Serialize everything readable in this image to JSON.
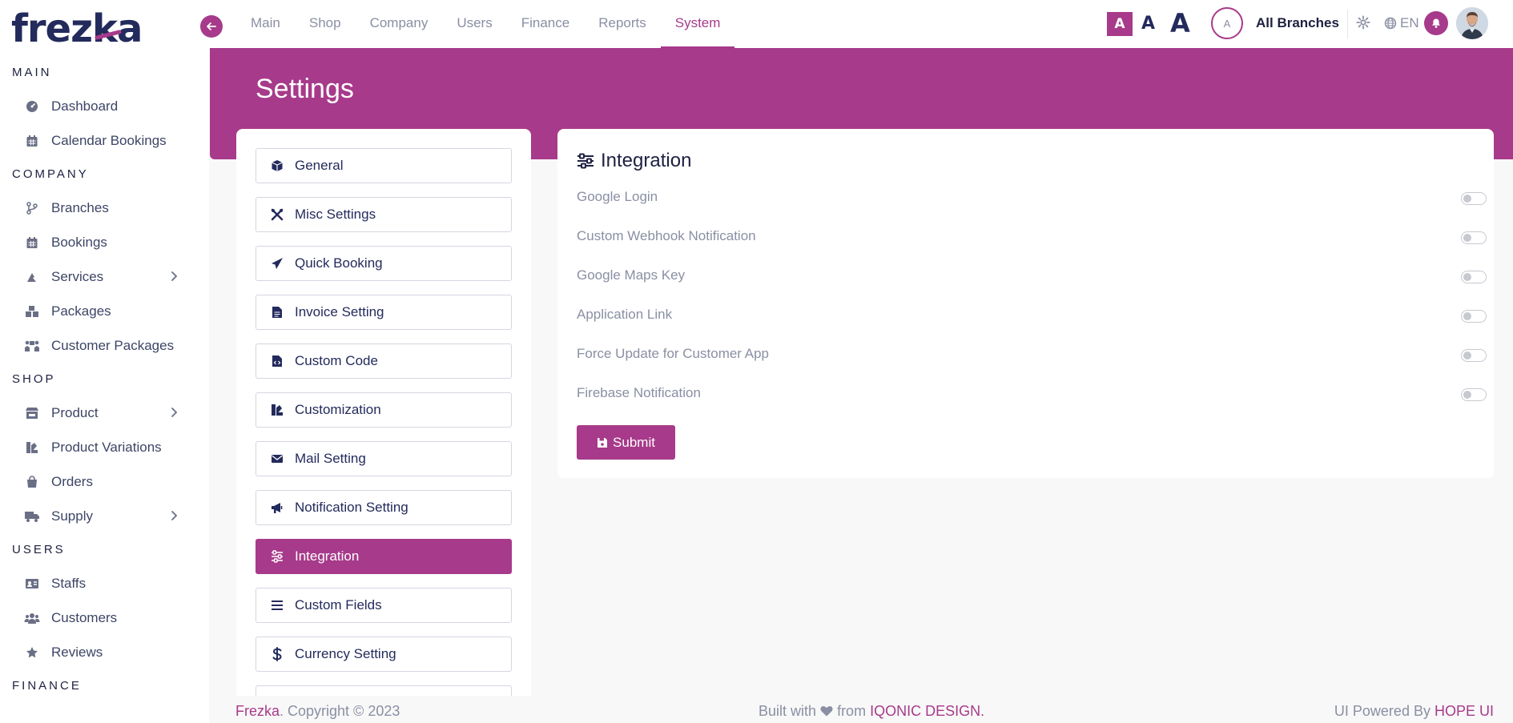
{
  "brand": {
    "logo_text_a": "frez",
    "logo_text_k": "k",
    "logo_text_b": "a"
  },
  "sidebar": {
    "sections": [
      {
        "title": "MAIN",
        "items": [
          {
            "label": "Dashboard",
            "icon": "dashboard-icon"
          },
          {
            "label": "Calendar Bookings",
            "icon": "calendar-icon"
          }
        ]
      },
      {
        "title": "COMPANY",
        "items": [
          {
            "label": "Branches",
            "icon": "branch-icon"
          },
          {
            "label": "Bookings",
            "icon": "calendar-icon"
          },
          {
            "label": "Services",
            "icon": "services-icon",
            "chevron": true
          },
          {
            "label": "Packages",
            "icon": "packages-icon"
          },
          {
            "label": "Customer Packages",
            "icon": "customer-packages-icon"
          }
        ]
      },
      {
        "title": "SHOP",
        "items": [
          {
            "label": "Product",
            "icon": "store-icon",
            "chevron": true
          },
          {
            "label": "Product Variations",
            "icon": "variations-icon"
          },
          {
            "label": "Orders",
            "icon": "bag-icon"
          },
          {
            "label": "Supply",
            "icon": "truck-icon",
            "chevron": true
          }
        ]
      },
      {
        "title": "USERS",
        "items": [
          {
            "label": "Staffs",
            "icon": "id-card-icon"
          },
          {
            "label": "Customers",
            "icon": "users-icon"
          },
          {
            "label": "Reviews",
            "icon": "star-icon"
          }
        ]
      },
      {
        "title": "FINANCE",
        "items": []
      }
    ]
  },
  "topbar": {
    "tabs": [
      "Main",
      "Shop",
      "Company",
      "Users",
      "Finance",
      "Reports",
      "System"
    ],
    "active_tab": "System",
    "font_size_labels": [
      "A",
      "A",
      "A"
    ],
    "branch_avatar": "A",
    "branch_name": "All Branches",
    "language": "EN"
  },
  "page": {
    "title": "Settings"
  },
  "settings_menu": [
    {
      "label": "General",
      "icon": "cube-icon"
    },
    {
      "label": "Misc Settings",
      "icon": "tools-icon"
    },
    {
      "label": "Quick Booking",
      "icon": "paper-plane-icon"
    },
    {
      "label": "Invoice Setting",
      "icon": "file-icon"
    },
    {
      "label": "Custom Code",
      "icon": "file-code-icon"
    },
    {
      "label": "Customization",
      "icon": "customization-icon"
    },
    {
      "label": "Mail Setting",
      "icon": "envelope-icon"
    },
    {
      "label": "Notification Setting",
      "icon": "megaphone-icon"
    },
    {
      "label": "Integration",
      "icon": "sliders-icon",
      "active": true
    },
    {
      "label": "Custom Fields",
      "icon": "list-icon"
    },
    {
      "label": "Currency Setting",
      "icon": "dollar-icon"
    }
  ],
  "integration": {
    "title": "Integration",
    "rows": [
      {
        "label": "Google Login",
        "enabled": false
      },
      {
        "label": "Custom Webhook Notification",
        "enabled": false
      },
      {
        "label": "Google Maps Key",
        "enabled": false
      },
      {
        "label": "Application Link",
        "enabled": false
      },
      {
        "label": "Force Update for Customer App",
        "enabled": false
      },
      {
        "label": "Firebase Notification",
        "enabled": false
      }
    ],
    "submit_label": "Submit"
  },
  "footer": {
    "brand": "Frezka",
    "copyright": ". Copyright © 2023",
    "built_with": "Built with",
    "from": "from",
    "company": "IQONIC DESIGN",
    "dot": ".",
    "powered_by": "UI Powered By",
    "ui_name": "HOPE UI"
  },
  "colors": {
    "accent": "#a73a8a",
    "navy": "#232a5c",
    "muted": "#8a8fa3"
  }
}
